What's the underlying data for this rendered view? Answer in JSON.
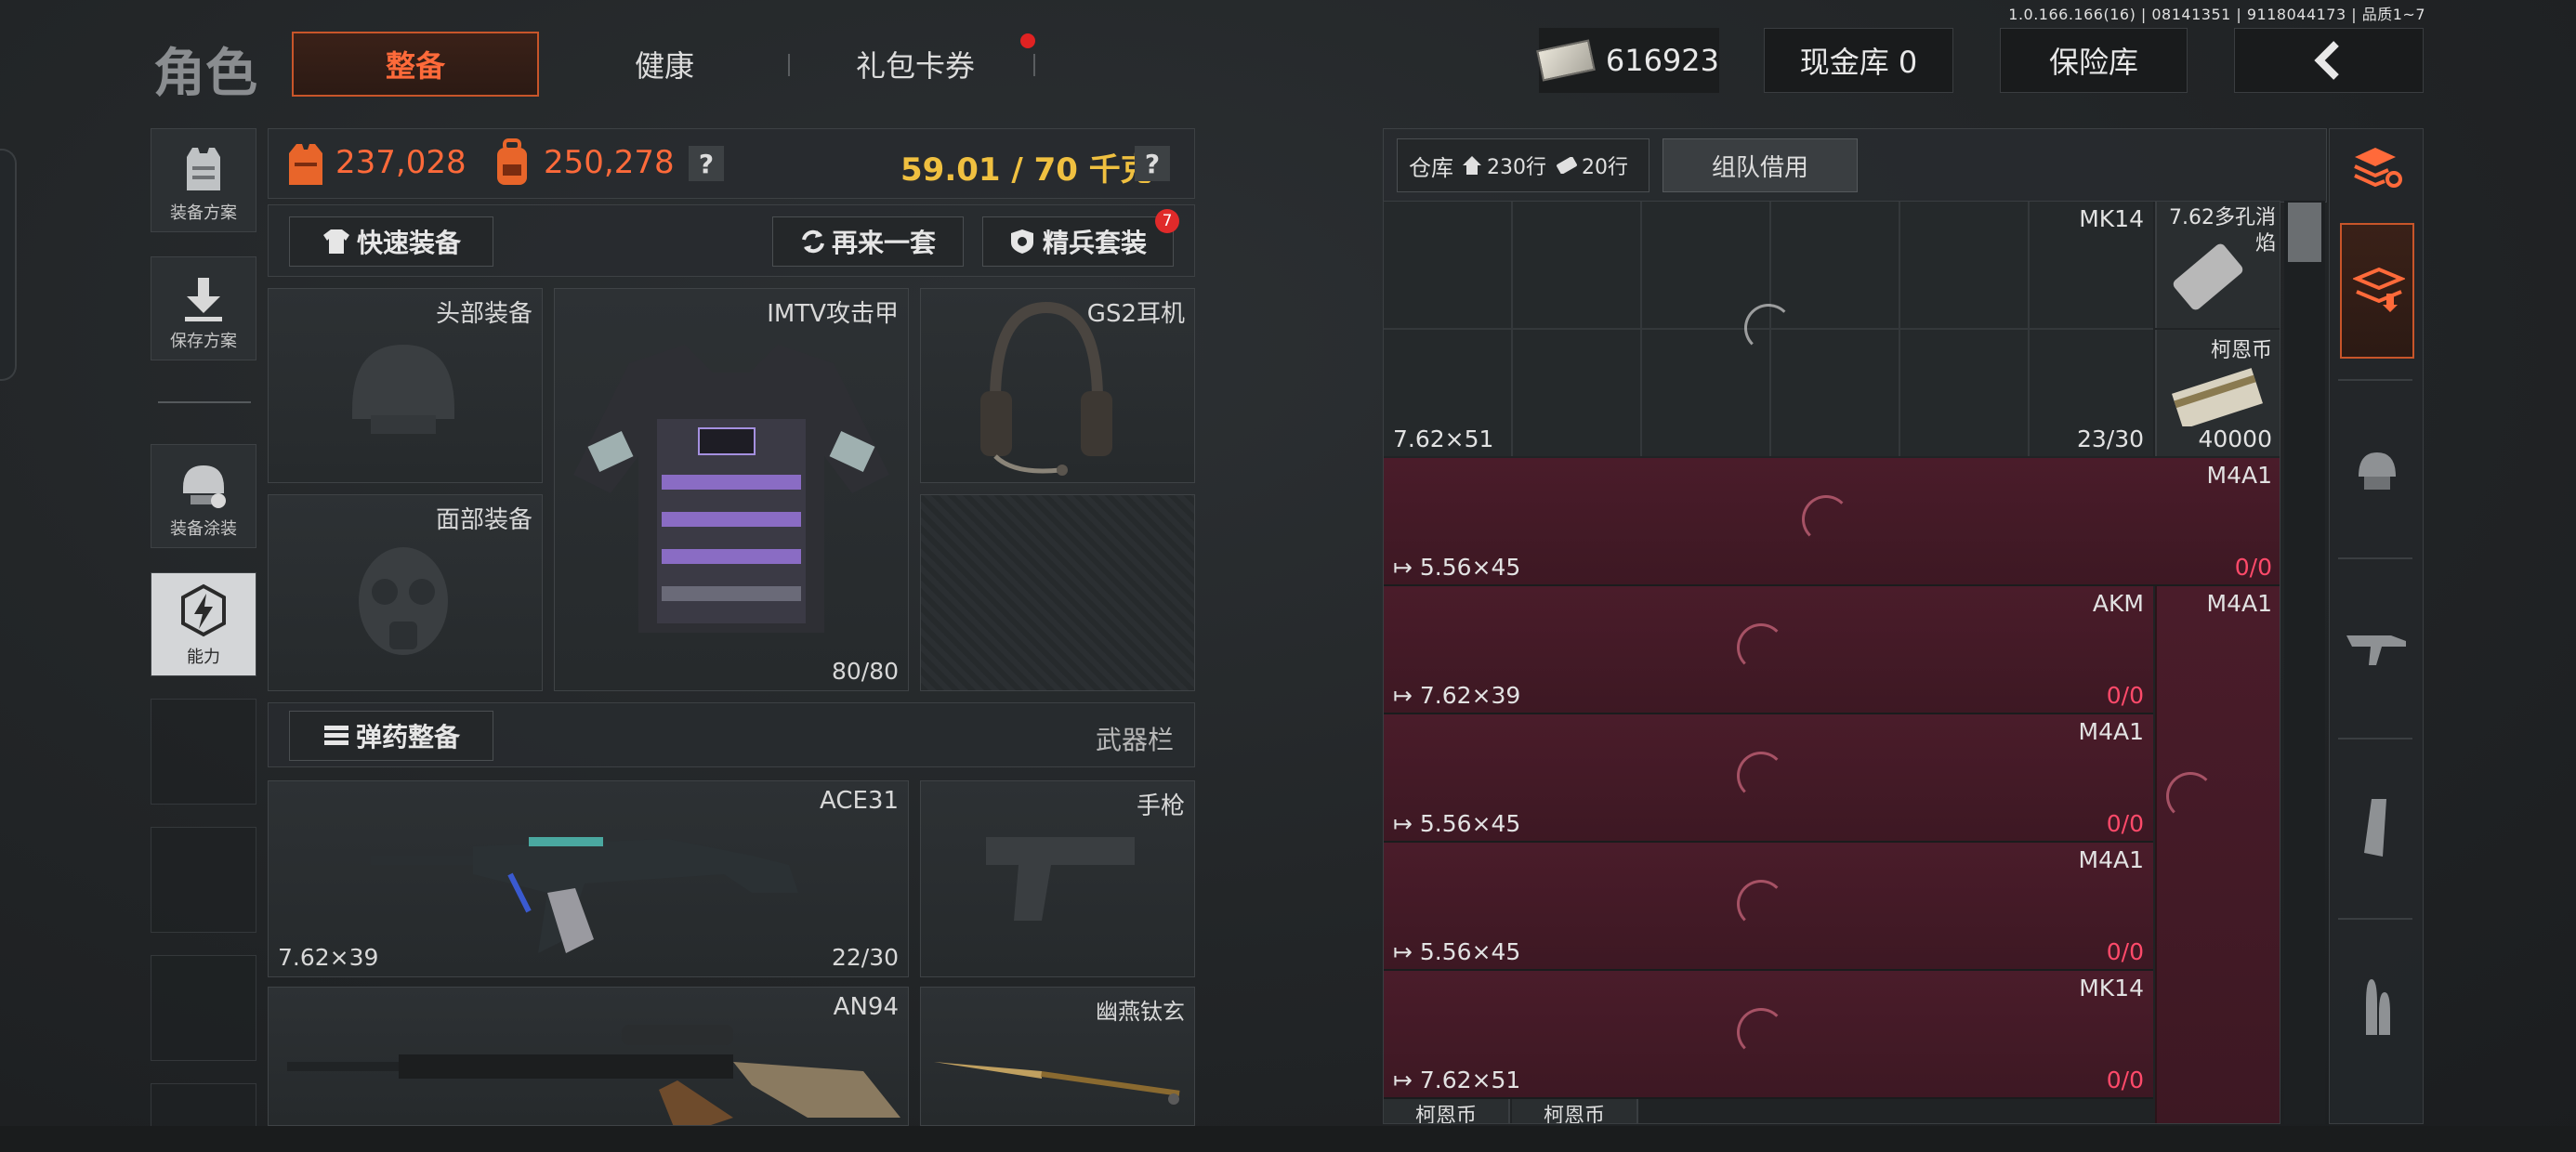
{
  "version": "1.0.166.166(16) | 08141351 | 9118044173 | 品质1~7",
  "header": {
    "title": "角色",
    "tabs": [
      {
        "label": "整备",
        "active": true
      },
      {
        "label": "健康",
        "active": false
      },
      {
        "label": "礼包卡券",
        "active": false,
        "badge_dot": true
      }
    ],
    "money": "616923",
    "cash_vault": "现金库 0",
    "insurance": "保险库",
    "back_icon": "chevron-left-icon"
  },
  "sidebar": {
    "items": [
      {
        "label": "装备方案",
        "icon": "vest-icon"
      },
      {
        "label": "保存方案",
        "icon": "download-icon"
      },
      {
        "label": "装备涂装",
        "icon": "helmet-paint-icon"
      },
      {
        "label": "能力",
        "icon": "lightning-hex-icon",
        "active": true
      }
    ]
  },
  "stats": {
    "value1": "237,028",
    "value2": "250,278",
    "help": "?",
    "weight": "59.01 / 70 千克",
    "help2": "?"
  },
  "actions": {
    "quick_equip": "快速装备",
    "another_set": "再来一套",
    "elite_set": "精兵套装",
    "elite_badge": "7",
    "ammo_equip": "弹药整备",
    "weapon_slot_label": "武器栏"
  },
  "gear": {
    "head": "头部装备",
    "face": "面部装备",
    "armor_name": "IMTV攻击甲",
    "armor_durability": "80/80",
    "headset": "GS2耳机"
  },
  "weapons": [
    {
      "name": "ACE31",
      "caliber": "7.62×39",
      "ammo": "22/30"
    },
    {
      "name": "手枪"
    },
    {
      "name": "AN94"
    },
    {
      "name": "幽燕钛玄"
    }
  ],
  "warehouse": {
    "label": "仓库",
    "rows_label": "230行",
    "rows_label2": "20行",
    "team_borrow": "组队借用",
    "top": {
      "name": "MK14",
      "caliber": "7.62×51",
      "ammo": "23/30"
    },
    "side_items": [
      {
        "name": "7.62多孔消焰"
      },
      {
        "name": "柯恩币",
        "count": "40000"
      }
    ],
    "rows": [
      {
        "name": "M4A1",
        "caliber": "5.56×45",
        "cur": "0",
        "max": "0"
      },
      {
        "name": "AKM",
        "caliber": "7.62×39",
        "cur": "0",
        "max": "0",
        "right_name": "M4A1"
      },
      {
        "name": "M4A1",
        "caliber": "5.56×45",
        "cur": "0",
        "max": "0"
      },
      {
        "name": "M4A1",
        "caliber": "5.56×45",
        "cur": "0",
        "max": "0"
      },
      {
        "name": "MK14",
        "caliber": "7.62×51",
        "cur": "0",
        "max": "0"
      }
    ],
    "bottom_labels": [
      "柯恩币",
      "柯恩币"
    ]
  },
  "colors": {
    "accent": "#ff6a3a",
    "gold": "#f0c040",
    "zero": "#ff4a6a"
  }
}
